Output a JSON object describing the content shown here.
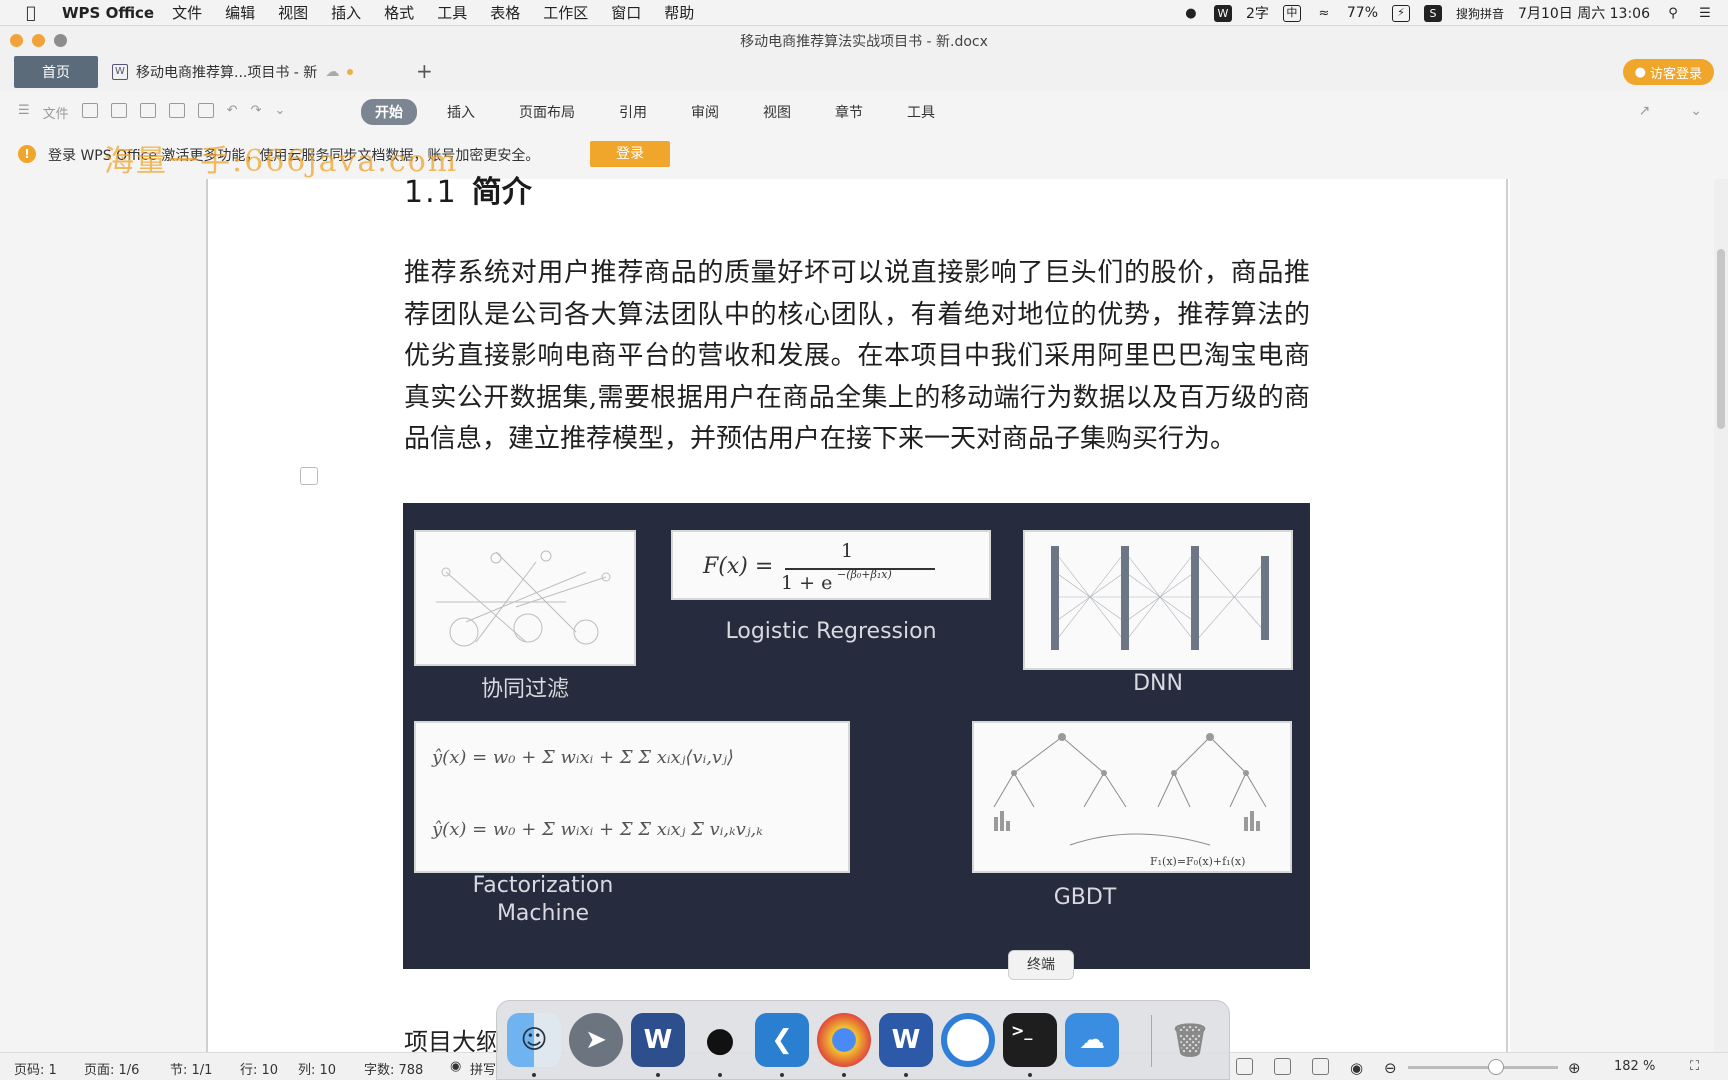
{
  "menubar": {
    "app_name": "WPS Office",
    "menus": [
      "文件",
      "编辑",
      "视图",
      "插入",
      "格式",
      "工具",
      "表格",
      "工作区",
      "窗口",
      "帮助"
    ],
    "status": {
      "word_count": "2字",
      "input_method_short": "中",
      "battery": "77%",
      "input_method": "搜狗拼音",
      "datetime": "7月10日 周六 13:06"
    }
  },
  "window": {
    "title": "移动电商推荐算法实战项目书 - 新.docx"
  },
  "tabs": {
    "home": "首页",
    "document": "移动电商推荐算...项目书 - 新",
    "visitor_login": "访客登录"
  },
  "ribbon": {
    "tabs": [
      "开始",
      "插入",
      "页面布局",
      "引用",
      "审阅",
      "视图",
      "章节",
      "工具"
    ],
    "active_tab": "开始",
    "quick_text": [
      "文件"
    ]
  },
  "notice": {
    "message": "登录 WPS Office 激活更多功能，使用云服务同步文档数据，账号加密更安全。",
    "login_label": "登录",
    "watermark": "海量一手:666java.com"
  },
  "document": {
    "heading_number": "1.1",
    "heading_text": "简介",
    "paragraph": "推荐系统对用户推荐商品的质量好坏可以说直接影响了巨头们的股价，商品推荐团队是公司各大算法团队中的核心团队，有着绝对地位的优势，推荐算法的优劣直接影响电商平台的营收和发展。在本项目中我们采用阿里巴巴淘宝电商真实公开数据集,需要根据用户在商品全集上的移动端行为数据以及百万级的商品信息，建立推荐模型，并预估用户在接下来一天对商品子集购买行为。",
    "next_heading": "项目大纲",
    "figure": {
      "labels": {
        "cf": "协同过滤",
        "lr": "Logistic Regression",
        "dnn": "DNN",
        "fm_line1": "Factorization",
        "fm_line2": "Machine",
        "gbdt": "GBDT"
      },
      "lr_formula": {
        "lhs": "F(x) =",
        "numerator": "1",
        "denominator": "1 + e",
        "exponent": "−(β₀+β₁x)"
      },
      "fm_formula_1": "ŷ(x) = w₀ + Σ wᵢxᵢ + Σ Σ xᵢxⱼ⟨vᵢ,vⱼ⟩",
      "fm_formula_2": "ŷ(x) = w₀ + Σ wᵢxᵢ + Σ Σ xᵢxⱼ Σ vᵢ,ₖvⱼ,ₖ",
      "gbdt_formula": "F₁(x)=F₀(x)+f₁(x)"
    }
  },
  "statusbar": {
    "page_num": "页码: 1",
    "pages": "页面: 1/6",
    "section": "节: 1/1",
    "row": "行: 10",
    "col": "列: 10",
    "words": "字数: 788",
    "spell": "拼写",
    "zoom": "182 %"
  },
  "dock": {
    "tooltip": "终端",
    "apps": [
      "finder-icon",
      "launchpad-icon",
      "word-icon",
      "qq-icon",
      "vscode-icon",
      "chrome-icon",
      "wps-icon",
      "activity-icon",
      "terminal-icon",
      "cloud-icon",
      "trash-icon"
    ]
  },
  "colors": {
    "accent": "#f0a62b",
    "figure_bg": "#262b3d",
    "active_tab": "#7c8692"
  }
}
